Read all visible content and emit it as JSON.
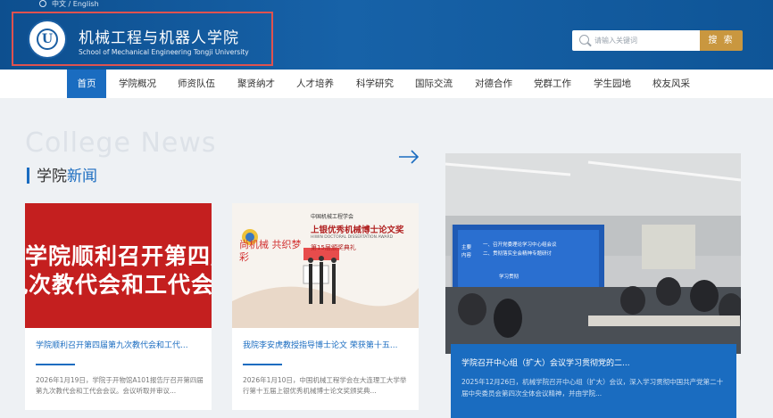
{
  "header": {
    "lang": "中文 / English",
    "cn_title": "机械工程与机器人学院",
    "en_title": "School of Mechanical Engineering Tongji University",
    "search_placeholder": "请输入关键词",
    "search_button": "搜 索"
  },
  "nav": {
    "items": [
      {
        "label": "首页",
        "active": true
      },
      {
        "label": "学院概况"
      },
      {
        "label": "师资队伍"
      },
      {
        "label": "聚贤纳才"
      },
      {
        "label": "人才培养"
      },
      {
        "label": "科学研究"
      },
      {
        "label": "国际交流"
      },
      {
        "label": "对德合作"
      },
      {
        "label": "党群工作"
      },
      {
        "label": "学生园地"
      },
      {
        "label": "校友风采"
      }
    ]
  },
  "section": {
    "watermark": "College News",
    "title_a": "学院",
    "title_b": "新闻"
  },
  "news": [
    {
      "image_lines": [
        "学院顺利召开第四届",
        "九次教代会和工代会"
      ],
      "title": "学院顺利召开第四届第九次教代会和工代...",
      "desc": "2026年1月19日，学院于开物馆A101报告厅召开第四届第九次教代会和工代会会议。会议听取并审议..."
    },
    {
      "image_text": {
        "org": "中国机械工程学会",
        "calligraphy": "尚机械 共织梦彩",
        "headline": "上银优秀机械博士论文奖",
        "en": "HIWIN DOCTORAL DISSERTATION AWARD",
        "ceremony": "第15届颁奖典礼"
      },
      "title": "我院李安虎教授指导博士论文 荣获第十五...",
      "desc": "2026年1月10日，中国机械工程学会在大连理工大学举行第十五届上银优秀机械博士论文奖颁奖典..."
    }
  ],
  "featured": {
    "screen_lines": [
      "一、召开党委理论学习中心组会议",
      "二、贯彻落实全会精神专题研讨"
    ],
    "screen_side": [
      "主要",
      "内容"
    ],
    "screen_footer": "学习贯彻",
    "title": "学院召开中心组（扩大）会议学习贯彻党的二...",
    "desc": "2025年12月26日，机械学院召开中心组（扩大）会议，深入学习贯彻中国共产党第二十届中央委员会第四次全体会议精神，并由学院..."
  },
  "colors": {
    "header_blue": "#1762a8",
    "nav_active": "#1a6cc0",
    "search_button": "#c9973f",
    "highlight_border": "#e0524f",
    "news_red": "#c41f1f"
  },
  "icons": [
    "globe-icon",
    "university-seal-logo",
    "search-icon",
    "arrow-right-icon"
  ]
}
